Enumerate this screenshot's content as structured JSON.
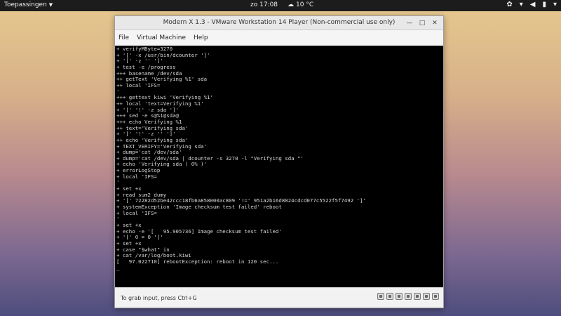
{
  "topbar": {
    "activities_label": "Toepassingen",
    "clock": "zo 17:08",
    "temperature": "10 °C",
    "weather_icon": "cloud-icon"
  },
  "window": {
    "title": "Modern X 1.3 - VMware Workstation 14 Player (Non-commercial use only)",
    "menu": [
      "File",
      "Virtual Machine",
      "Help"
    ]
  },
  "console_lines": [
    "+ verifyMByte=3270",
    "+ '[' -x /usr/bin/dcounter ']'",
    "+ '[' -z '' ']'",
    "+ test -e /progress",
    "+++ basename /dev/sda",
    "++ getText 'Verifying %1' sda",
    "++ local 'IFS=",
    "'",
    "+++ gettext kiwi 'Verifying %1'",
    "++ local 'text=Verifying %1'",
    "+ '[' '!' -z sda ']'",
    "+++ sed -e s@%1@sda@",
    "+++ echo Verifying %1",
    "++ text='Verifying sda'",
    "+ '[' '!' -z '' ']'",
    "++ echo 'Verifying sda'",
    "+ TEXT_VERIFY='Verifying sda'",
    "+ dump='cat /dev/sda'",
    "+ dump='cat /dev/sda | dcounter -s 3270 -l \"Verifying sda \"'",
    "+ echo 'Verifying sda ( 0% )'",
    "+ errorLogStop",
    "+ local 'IFS=",
    "'",
    "+ set +x",
    "+ read sum2 dumy",
    "+ '[' 72282d52be42ccc18fb6a858000ac809 '!=' 951a2b16d8824cdcd077c5522f5f7492 ']'",
    "+ systemException 'Image checksum test failed' reboot",
    "+ local 'IFS=",
    "'",
    "+ set +x",
    "+ echo -e '[   95.905736] Image checksum test failed'",
    "+ '[' 0 = 0 ']'",
    "+ set +x",
    "+ case \"$what\" in",
    "+ cat /var/log/boot.kiwi",
    "[   97.022710] rebootException: reboot in 120 sec...",
    "_"
  ],
  "statusbar": {
    "hint": "To grab input, press Ctrl+G",
    "devices": [
      "hard-disk-icon",
      "cd-drive-icon",
      "floppy-icon",
      "network-icon",
      "usb-icon",
      "sound-icon",
      "display-icon"
    ]
  }
}
